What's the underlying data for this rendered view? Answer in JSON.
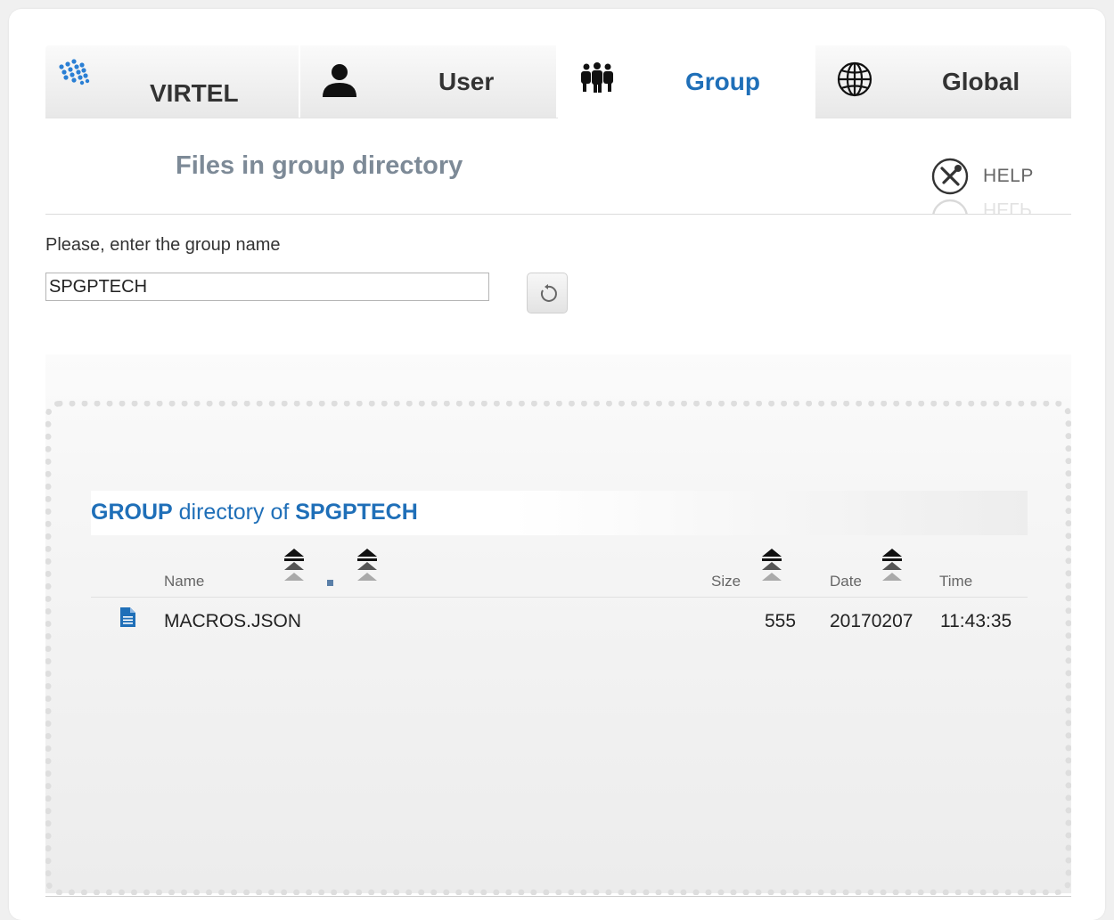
{
  "tabs": [
    {
      "label": "VIRTEL",
      "icon": "virtel-logo-icon"
    },
    {
      "label": "User",
      "icon": "user-icon"
    },
    {
      "label": "Group",
      "icon": "group-icon",
      "active": true
    },
    {
      "label": "Global",
      "icon": "globe-icon"
    }
  ],
  "page": {
    "title": "Files in group directory",
    "help_label": "HELP"
  },
  "form": {
    "prompt": "Please, enter the group name",
    "group_value": "SPGPTECH"
  },
  "directory": {
    "title_prefix": "GROUP",
    "title_middle": " directory of ",
    "title_group": "SPGPTECH",
    "columns": {
      "name": "Name",
      "size": "Size",
      "date": "Date",
      "time": "Time"
    },
    "files": [
      {
        "name": "MACROS.JSON",
        "size": "555",
        "date": "20170207",
        "time": "11:43:35",
        "icon": "file-icon"
      }
    ]
  },
  "colors": {
    "accent": "#1f6fb8",
    "title_gray": "#7d8a97"
  }
}
